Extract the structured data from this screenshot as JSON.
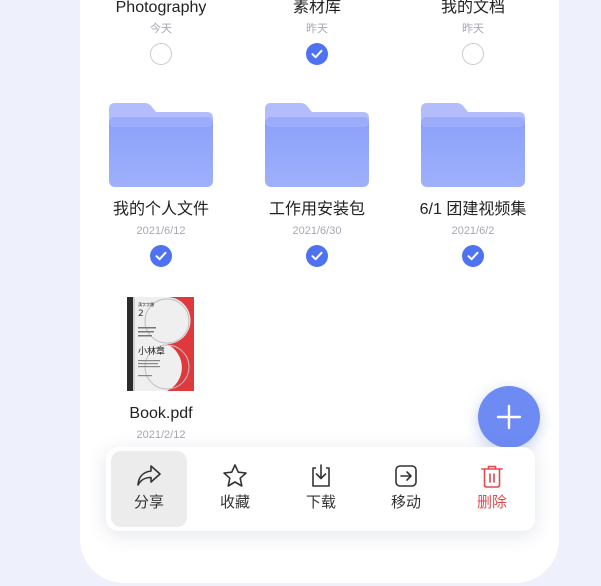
{
  "files": [
    {
      "name": "Photography",
      "date": "今天",
      "checked": false,
      "kind": "folder"
    },
    {
      "name": "素材库",
      "date": "昨天",
      "checked": true,
      "kind": "folder"
    },
    {
      "name": "我的文档",
      "date": "昨天",
      "checked": false,
      "kind": "folder"
    },
    {
      "name": "我的个人文件",
      "date": "2021/6/12",
      "checked": true,
      "kind": "folder"
    },
    {
      "name": "工作用安装包",
      "date": "2021/6/30",
      "checked": true,
      "kind": "folder"
    },
    {
      "name": "6/1 团建视频集",
      "date": "2021/6/2",
      "checked": true,
      "kind": "folder"
    },
    {
      "name": "Book.pdf",
      "date": "2021/2/12",
      "checked": false,
      "kind": "pdf"
    }
  ],
  "book_cover": {
    "number": "2",
    "title": "小林章"
  },
  "toolbar": {
    "share": "分享",
    "favorite": "收藏",
    "download": "下载",
    "move": "移动",
    "delete": "删除"
  },
  "colors": {
    "accent": "#4f73f0",
    "fab": "#6e8bf4",
    "danger": "#e5484d",
    "folder_top": "#a4aefc",
    "folder_front": "#7e95f7"
  }
}
